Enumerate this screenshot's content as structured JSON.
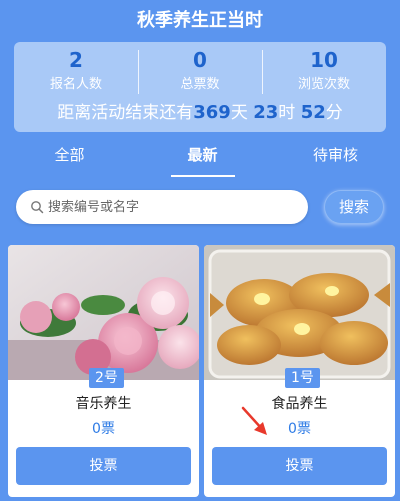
{
  "header": {
    "title": "秋季养生正当时"
  },
  "stats": [
    {
      "value": "2",
      "label": "报名人数"
    },
    {
      "value": "0",
      "label": "总票数"
    },
    {
      "value": "10",
      "label": "浏览次数"
    }
  ],
  "countdown": {
    "prefix": "距离活动结束还有",
    "days": "369",
    "day_unit": "天",
    "hours": "23",
    "hour_unit": "时",
    "minutes": "52",
    "minute_unit": "分"
  },
  "tabs": [
    {
      "label": "全部",
      "active": false
    },
    {
      "label": "最新",
      "active": true
    },
    {
      "label": "待审核",
      "active": false
    }
  ],
  "search": {
    "placeholder": "搜索编号或名字",
    "value": "",
    "button_label": "搜索"
  },
  "entries": [
    {
      "number_label": "2号",
      "name": "音乐养生",
      "votes": "0票",
      "vote_button": "投票",
      "image": "pink-peonies-photo"
    },
    {
      "number_label": "1号",
      "name": "食品养生",
      "votes": "0票",
      "vote_button": "投票",
      "image": "fish-shaped-pastries-photo"
    }
  ],
  "colors": {
    "primary": "#5b95ef",
    "stats_panel": "#a9c9f7",
    "accent_number": "#1e63cc",
    "vote_count": "#2d7be6",
    "annotation_arrow": "#e8392c"
  }
}
